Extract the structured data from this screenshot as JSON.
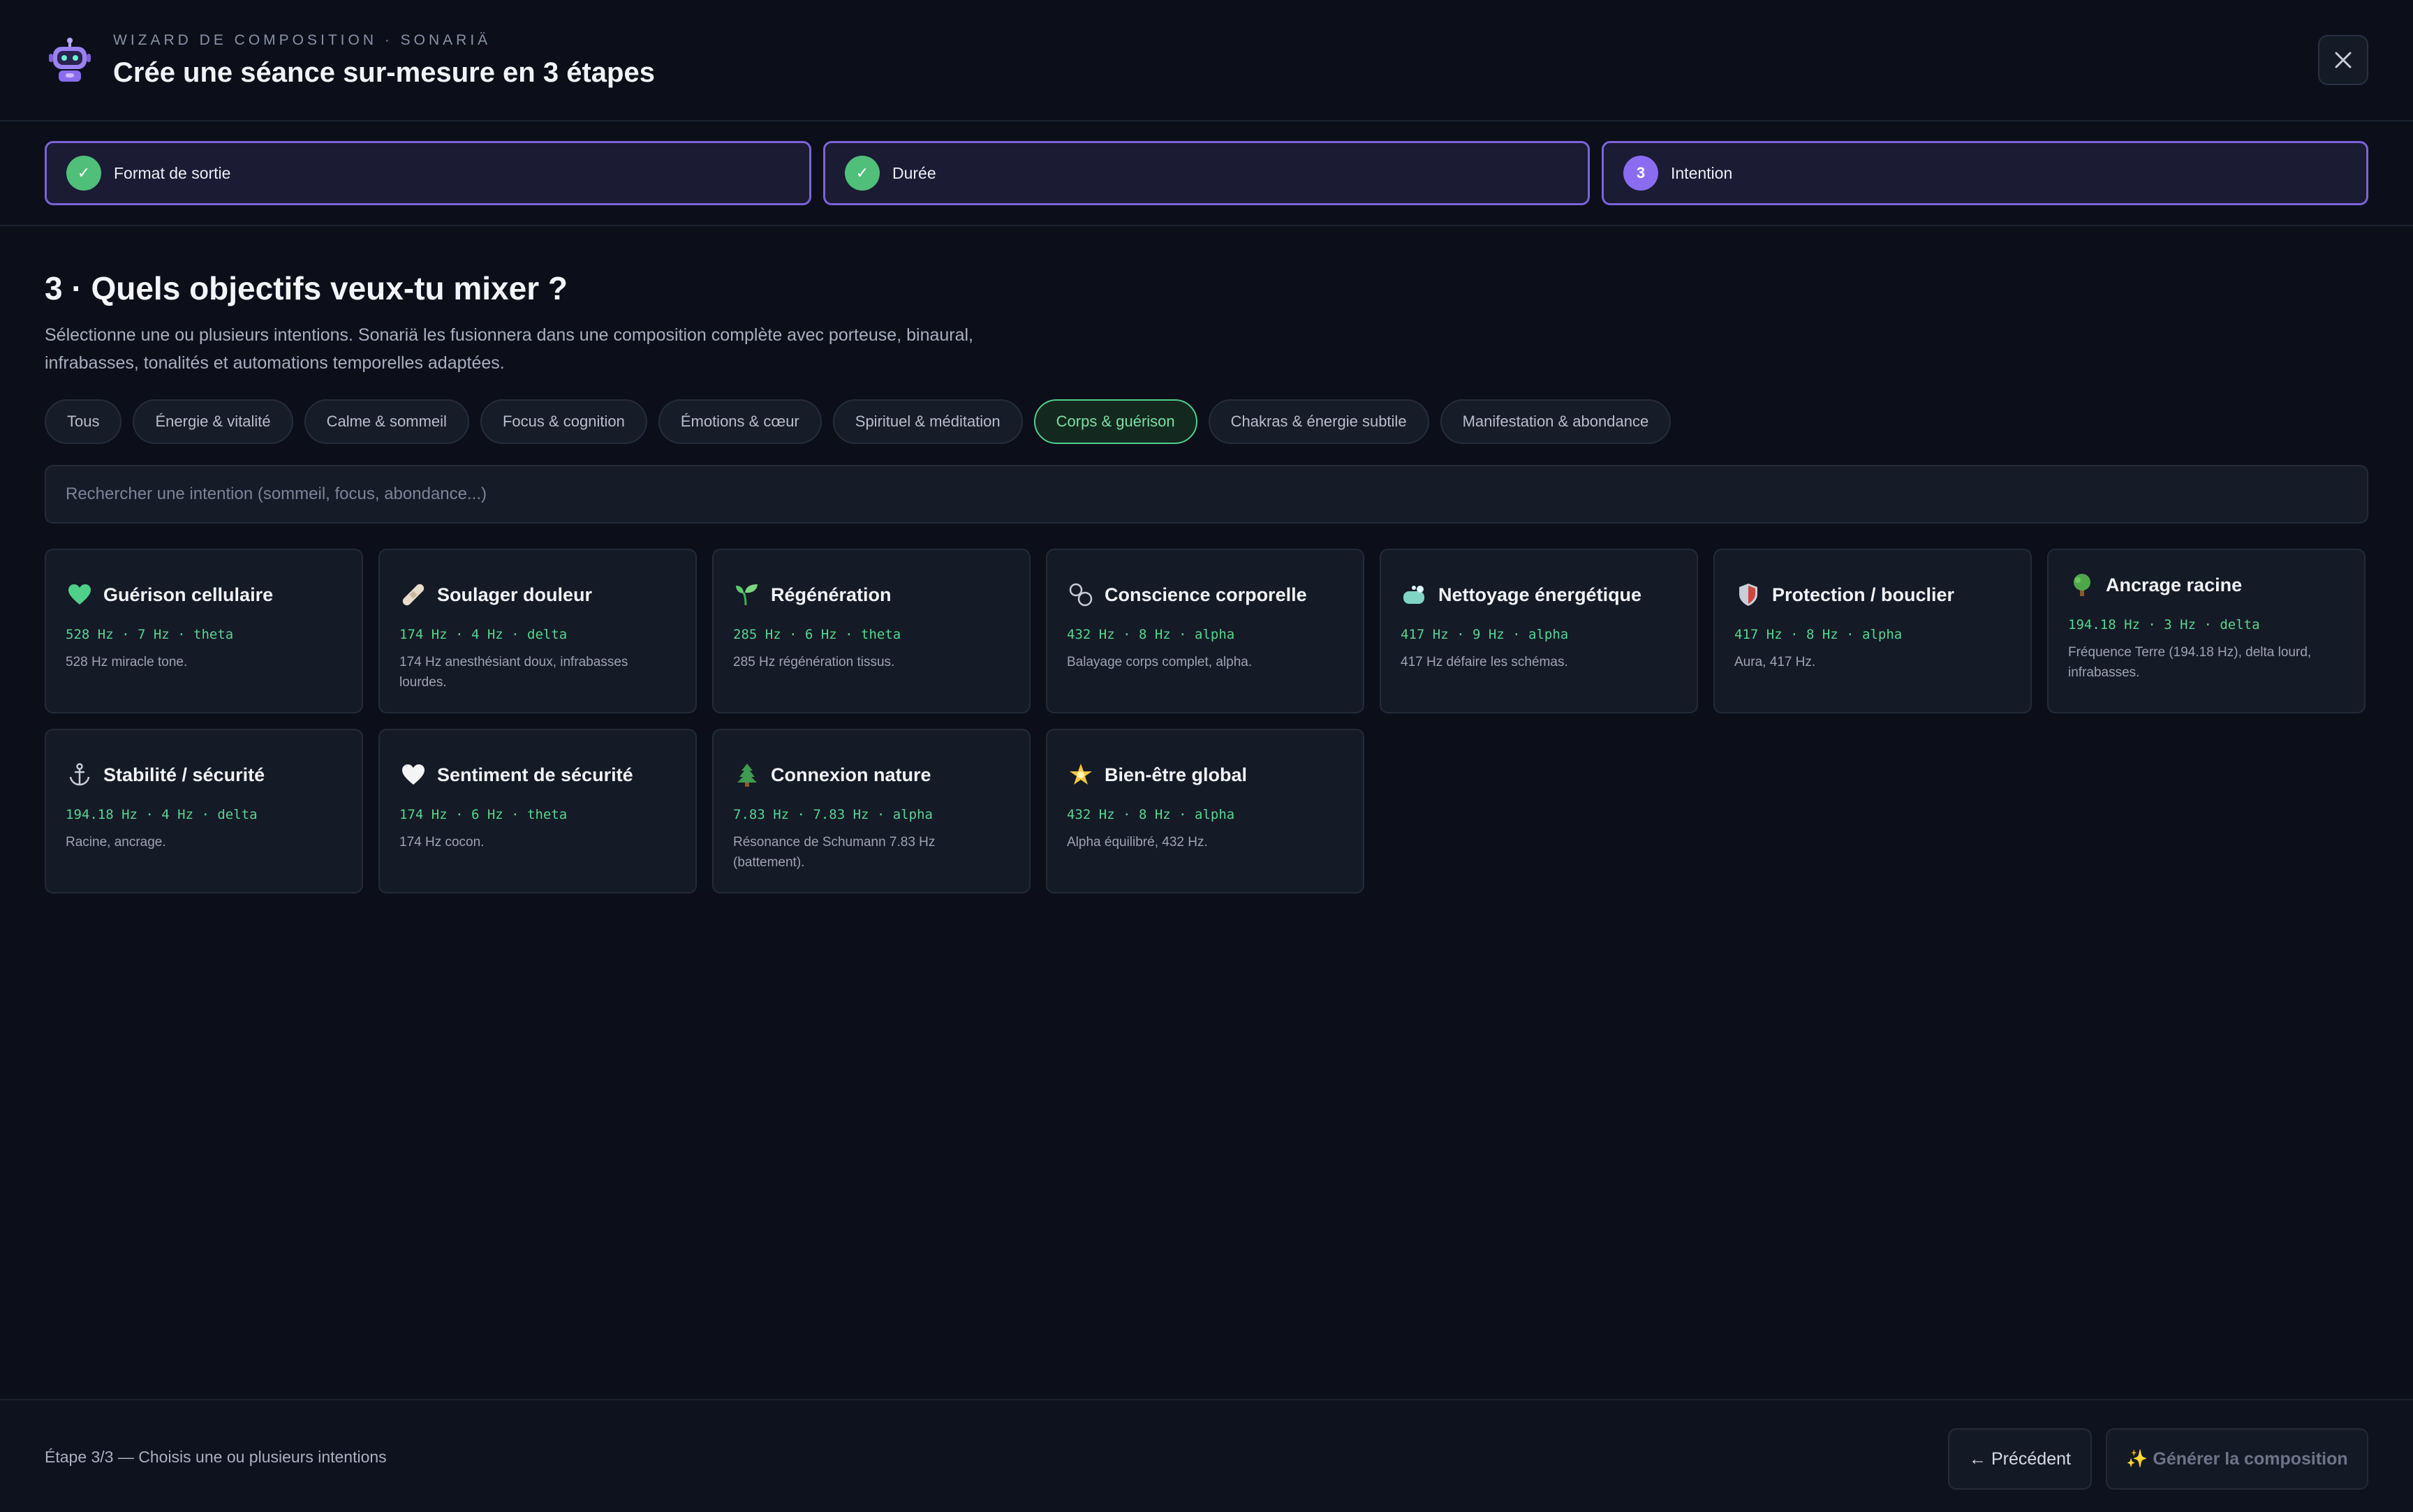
{
  "header": {
    "eyebrow": "WIZARD DE COMPOSITION · SONARIÄ",
    "title": "Crée une séance sur-mesure en 3 étapes"
  },
  "steps": [
    {
      "label": "Format de sortie",
      "status": "done",
      "marker": "✓"
    },
    {
      "label": "Durée",
      "status": "done",
      "marker": "✓"
    },
    {
      "label": "Intention",
      "status": "current",
      "marker": "3"
    }
  ],
  "main": {
    "section_title": "3 · Quels objectifs veux-tu mixer ?",
    "section_desc": "Sélectionne une ou plusieurs intentions. Sonariä les fusionnera dans une composition complète avec porteuse, binaural, infrabasses, tonalités et automations temporelles adaptées.",
    "categories": [
      {
        "label": "Tous"
      },
      {
        "label": "Énergie & vitalité"
      },
      {
        "label": "Calme & sommeil"
      },
      {
        "label": "Focus & cognition"
      },
      {
        "label": "Émotions & cœur"
      },
      {
        "label": "Spirituel & méditation"
      },
      {
        "label": "Corps & guérison",
        "active": true
      },
      {
        "label": "Chakras & énergie subtile"
      },
      {
        "label": "Manifestation & abondance"
      }
    ],
    "search_placeholder": "Rechercher une intention (sommeil, focus, abondance...)",
    "intentions": [
      {
        "icon": "green-heart-icon",
        "title": "Guérison cellulaire",
        "freq": "528 Hz · 7 Hz · theta",
        "desc": "528 Hz miracle tone."
      },
      {
        "icon": "bandage-icon",
        "title": "Soulager douleur",
        "freq": "174 Hz · 4 Hz · delta",
        "desc": "174 Hz anesthésiant doux, infrabasses lourdes."
      },
      {
        "icon": "seedling-icon",
        "title": "Régénération",
        "freq": "285 Hz · 6 Hz · theta",
        "desc": "285 Hz régénération tissus."
      },
      {
        "icon": "body-scan-icon",
        "title": "Conscience corporelle",
        "freq": "432 Hz · 8 Hz · alpha",
        "desc": "Balayage corps complet, alpha."
      },
      {
        "icon": "soap-icon",
        "title": "Nettoyage énergétique",
        "freq": "417 Hz · 9 Hz · alpha",
        "desc": "417 Hz défaire les schémas."
      },
      {
        "icon": "shield-icon",
        "title": "Protection / bouclier",
        "freq": "417 Hz · 8 Hz · alpha",
        "desc": "Aura, 417 Hz."
      },
      {
        "icon": "tree-icon",
        "title": "Ancrage racine",
        "freq": "194.18 Hz · 3 Hz · delta",
        "desc": "Fréquence Terre (194.18 Hz), delta lourd, infrabasses."
      },
      {
        "icon": "anchor-icon",
        "title": "Stabilité / sécurité",
        "freq": "194.18 Hz · 4 Hz · delta",
        "desc": "Racine, ancrage."
      },
      {
        "icon": "white-heart-icon",
        "title": "Sentiment de sécurité",
        "freq": "174 Hz · 6 Hz · theta",
        "desc": "174 Hz cocon."
      },
      {
        "icon": "evergreen-tree-icon",
        "title": "Connexion nature",
        "freq": "7.83 Hz · 7.83 Hz · alpha",
        "desc": "Résonance de Schumann 7.83 Hz (battement)."
      },
      {
        "icon": "star-icon",
        "title": "Bien-être global",
        "freq": "432 Hz · 8 Hz · alpha",
        "desc": "Alpha équilibré, 432 Hz."
      }
    ]
  },
  "footer": {
    "status": "Étape 3/3 — Choisis une ou plusieurs intentions",
    "prev_label": "← Précédent",
    "generate_label": "✨ Générer la composition"
  }
}
